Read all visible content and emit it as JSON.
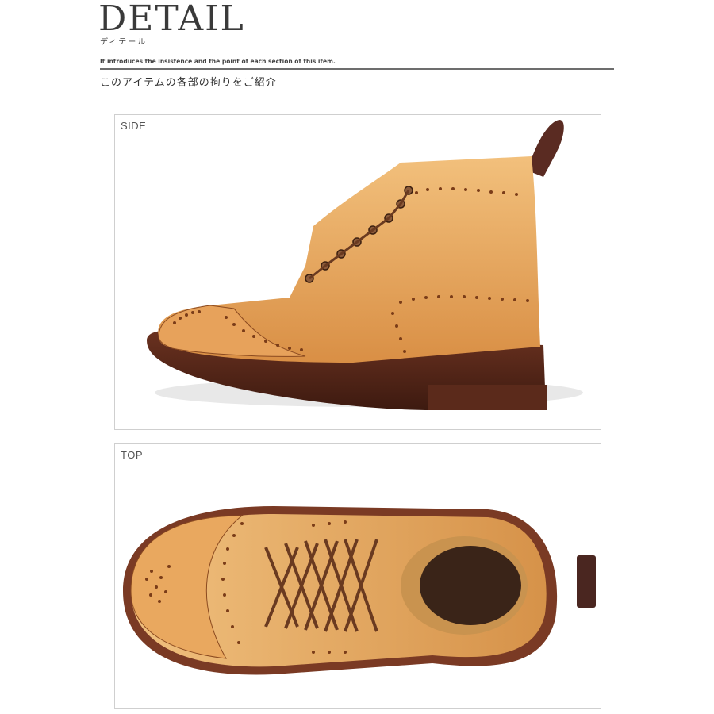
{
  "header": {
    "title": "DETAIL",
    "title_kana": "ディテール",
    "intro": "It introduces the insistence and the point of each section of this item.",
    "subtitle": "このアイテムの各部の拘りをご紹介"
  },
  "panels": [
    {
      "label": "SIDE",
      "image": "boot-side-view"
    },
    {
      "label": "TOP",
      "image": "boot-top-view"
    }
  ],
  "colors": {
    "leather": "#e0a15a",
    "leather_light": "#f0c07e",
    "sole": "#5a2a1a",
    "rule": "#6d6d6d"
  }
}
